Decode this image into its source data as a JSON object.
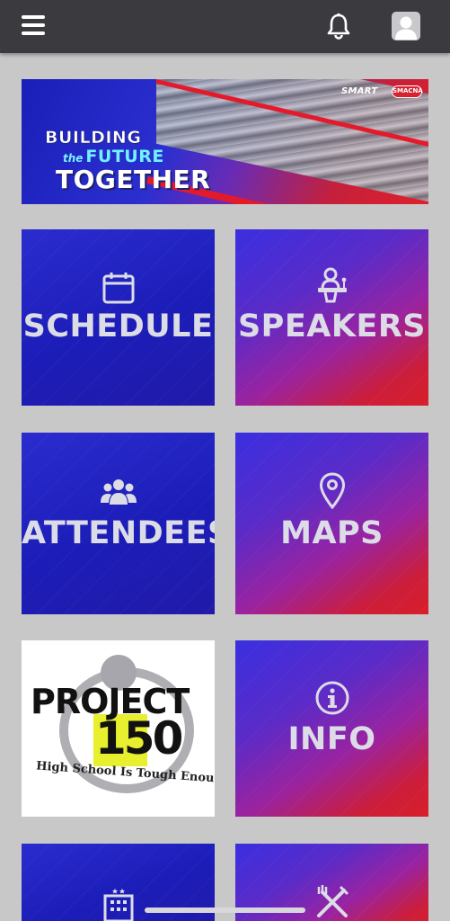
{
  "header": {
    "menu_icon": "hamburger-menu-icon",
    "notifications_icon": "bell-icon",
    "profile_icon": "user-avatar-icon"
  },
  "banner": {
    "line1": "BUILDING",
    "line2_small": "the",
    "line2_big": "FUTURE",
    "line3": "TOGETHER",
    "brand1": "SMART",
    "brand2": "SMACNA"
  },
  "tiles": [
    {
      "label": "SCHEDULE",
      "icon": "calendar-icon"
    },
    {
      "label": "SPEAKERS",
      "icon": "speaker-podium-icon"
    },
    {
      "label": "ATTENDEES",
      "icon": "users-group-icon"
    },
    {
      "label": "MAPS",
      "icon": "map-pin-icon"
    },
    {
      "label": "",
      "icon": ""
    },
    {
      "label": "INFO",
      "icon": "info-circle-icon"
    },
    {
      "label": "",
      "icon": "building-icon"
    },
    {
      "label": "",
      "icon": "fork-knife-icon"
    }
  ],
  "promo": {
    "title": "PROJECT",
    "number": "150",
    "tagline": "High School Is Tough Enough"
  },
  "colors": {
    "topbar": "#3b3b3f",
    "background": "#c8c8c8",
    "tile_blue": "#1f20c0",
    "tile_red": "#d81e2a"
  }
}
